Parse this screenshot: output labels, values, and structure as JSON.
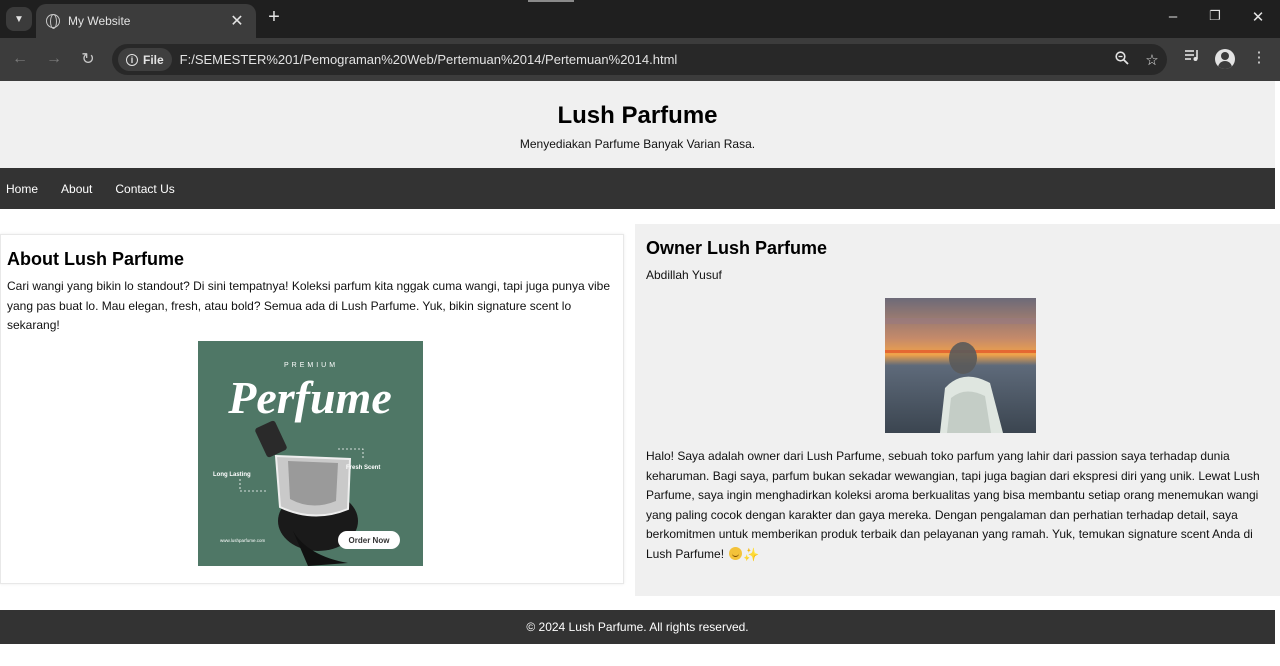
{
  "browser": {
    "tab_title": "My Website",
    "new_tab_symbol": "+",
    "url_chip": "File",
    "url": "F:/SEMESTER%201/Pemograman%20Web/Pertemuan%2014/Pertemuan%2014.html"
  },
  "site": {
    "title": "Lush Parfume",
    "tagline": "Menyediakan Parfume Banyak Varian Rasa.",
    "nav": [
      "Home",
      "About",
      "Contact Us"
    ]
  },
  "about": {
    "heading": "About Lush Parfume",
    "text": "Cari wangi yang bikin lo standout? Di sini tempatnya! Koleksi parfum kita nggak cuma wangi, tapi juga punya vibe yang pas buat lo. Mau elegan, fresh, atau bold? Semua ada di Lush Parfume. Yuk, bikin signature scent lo sekarang!",
    "image": {
      "premium": "PREMIUM",
      "script_title": "Perfume",
      "long_lasting": "Long Lasting",
      "fresh_scent": "Fresh Scent",
      "site": "www.lushparfume.com",
      "cta": "Order Now",
      "bg_color": "#4f7766"
    }
  },
  "owner": {
    "heading": "Owner Lush Parfume",
    "name": "Abdillah Yusuf",
    "bio": "Halo! Saya adalah owner dari Lush Parfume, sebuah toko parfum yang lahir dari passion saya terhadap dunia keharuman. Bagi saya, parfum bukan sekadar wewangian, tapi juga bagian dari ekspresi diri yang unik. Lewat Lush Parfume, saya ingin menghadirkan koleksi aroma berkualitas yang bisa membantu setiap orang menemukan wangi yang paling cocok dengan karakter dan gaya mereka. Dengan pengalaman dan perhatian terhadap detail, saya berkomitmen untuk memberikan produk terbaik dan pelayanan yang ramah. Yuk, temukan signature scent Anda di Lush Parfume!"
  },
  "footer": {
    "text": "© 2024 Lush Parfume. All rights reserved."
  },
  "icons": [
    "tab-search-icon",
    "globe-icon",
    "close-icon",
    "back-icon",
    "forward-icon",
    "reload-icon",
    "info-icon",
    "zoom-icon",
    "star-icon",
    "media-icon",
    "profile-icon",
    "menu-icon"
  ],
  "colors": {
    "header_bg": "#f0f0f0",
    "nav_bg": "#333333",
    "footer_bg": "#333333",
    "owner_bg": "#f0f0f0"
  }
}
